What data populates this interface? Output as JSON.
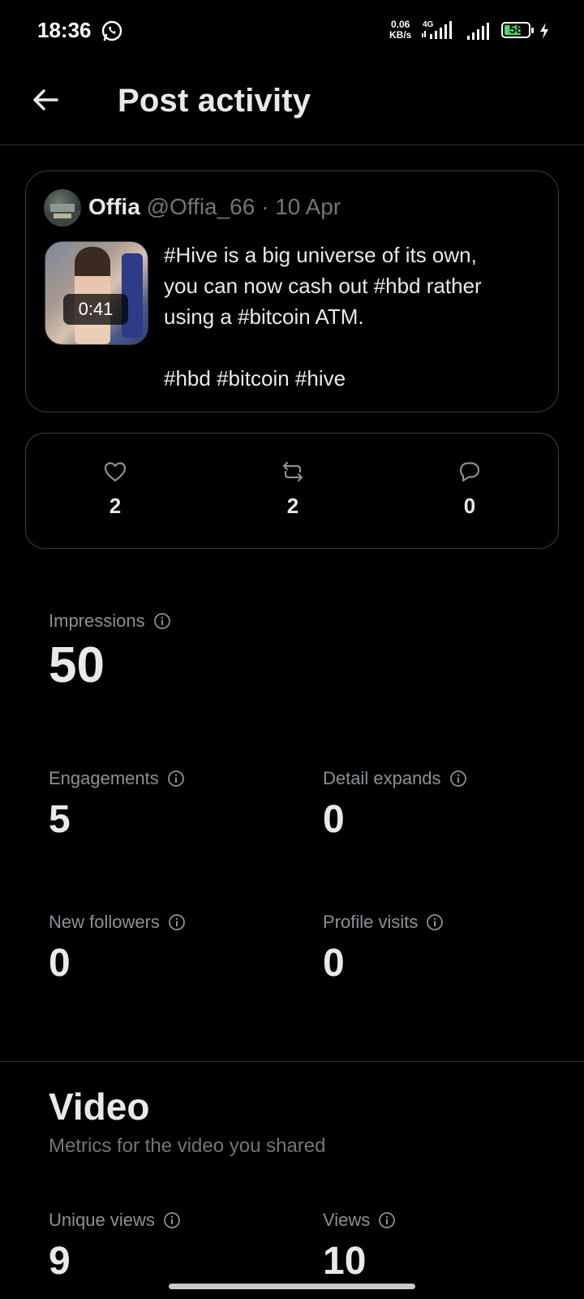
{
  "status_bar": {
    "time": "18:36",
    "net_speed_value": "0.06",
    "net_speed_unit": "KB/s",
    "network_type": "4G",
    "battery_level": "58",
    "icons": [
      "whatsapp-icon",
      "signal-4g-icon",
      "signal-icon",
      "battery-icon",
      "charging-icon"
    ]
  },
  "header": {
    "title": "Post activity",
    "back_icon": "arrow-left-icon"
  },
  "post": {
    "author_name": "Offia",
    "meta": "@Offia_66 · 10 Apr",
    "video_duration": "0:41",
    "text": "#Hive is a big universe of its own,\nyou can now cash out #hbd rather\nusing a #bitcoin ATM.\n\n#hbd #bitcoin #hive"
  },
  "engagement": {
    "likes": "2",
    "reposts": "2",
    "replies": "0",
    "icons": [
      "heart-icon",
      "repost-icon",
      "reply-icon"
    ]
  },
  "metrics": {
    "impressions": {
      "label": "Impressions",
      "value": "50"
    },
    "engagements": {
      "label": "Engagements",
      "value": "5"
    },
    "detail_expands": {
      "label": "Detail expands",
      "value": "0"
    },
    "new_followers": {
      "label": "New followers",
      "value": "0"
    },
    "profile_visits": {
      "label": "Profile visits",
      "value": "0"
    }
  },
  "video": {
    "title": "Video",
    "subtitle": "Metrics for the video you shared",
    "unique_views": {
      "label": "Unique views",
      "value": "9"
    },
    "views": {
      "label": "Views",
      "value": "10"
    }
  },
  "colors": {
    "background": "#000000",
    "text_primary": "#e7e9ea",
    "text_secondary": "#71767b",
    "border": "#3a3f44",
    "battery": "#4cd964"
  }
}
